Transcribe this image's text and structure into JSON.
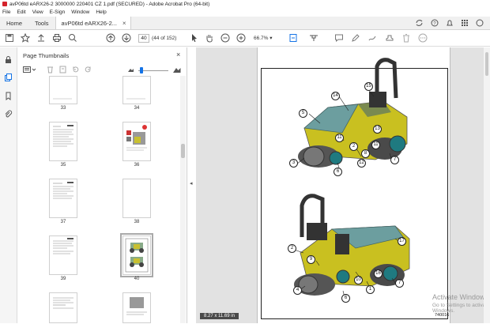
{
  "window": {
    "title": "avP06td eARX26-2 3000000 220401 CZ 1.pdf (SECURED) - Adobe Acrobat Pro (64-bit)"
  },
  "menu": [
    "File",
    "Edit",
    "View",
    "E-Sign",
    "Window",
    "Help"
  ],
  "tabs": {
    "home": "Home",
    "tools": "Tools",
    "document": "avP06td eARX26-2..."
  },
  "toolbar": {
    "page_current": "40",
    "page_count": "(44 of 152)",
    "zoom": "66.7%"
  },
  "thumbnails_panel": {
    "title": "Page Thumbnails",
    "pages": [
      "33",
      "34",
      "35",
      "36",
      "37",
      "38",
      "39",
      "40"
    ],
    "selected_page": "40"
  },
  "document": {
    "page_size": "8.27 x 11.69 in",
    "figure_id": "740016",
    "callouts_top": [
      "15",
      "14",
      "5",
      "13",
      "11",
      "2",
      "11",
      "3",
      "8",
      "12",
      "6",
      "7"
    ],
    "callouts_bottom": [
      "2",
      "9",
      "17",
      "10",
      "16",
      "4",
      "1",
      "6",
      "7"
    ]
  },
  "watermark": {
    "line1": "Activate Windows",
    "line2": "Go to Settings to activate Windows."
  },
  "colors": {
    "accent": "#1473e6",
    "machine_body": "#c9c020",
    "tank": "#6c9e9f",
    "roller": "#444444"
  }
}
